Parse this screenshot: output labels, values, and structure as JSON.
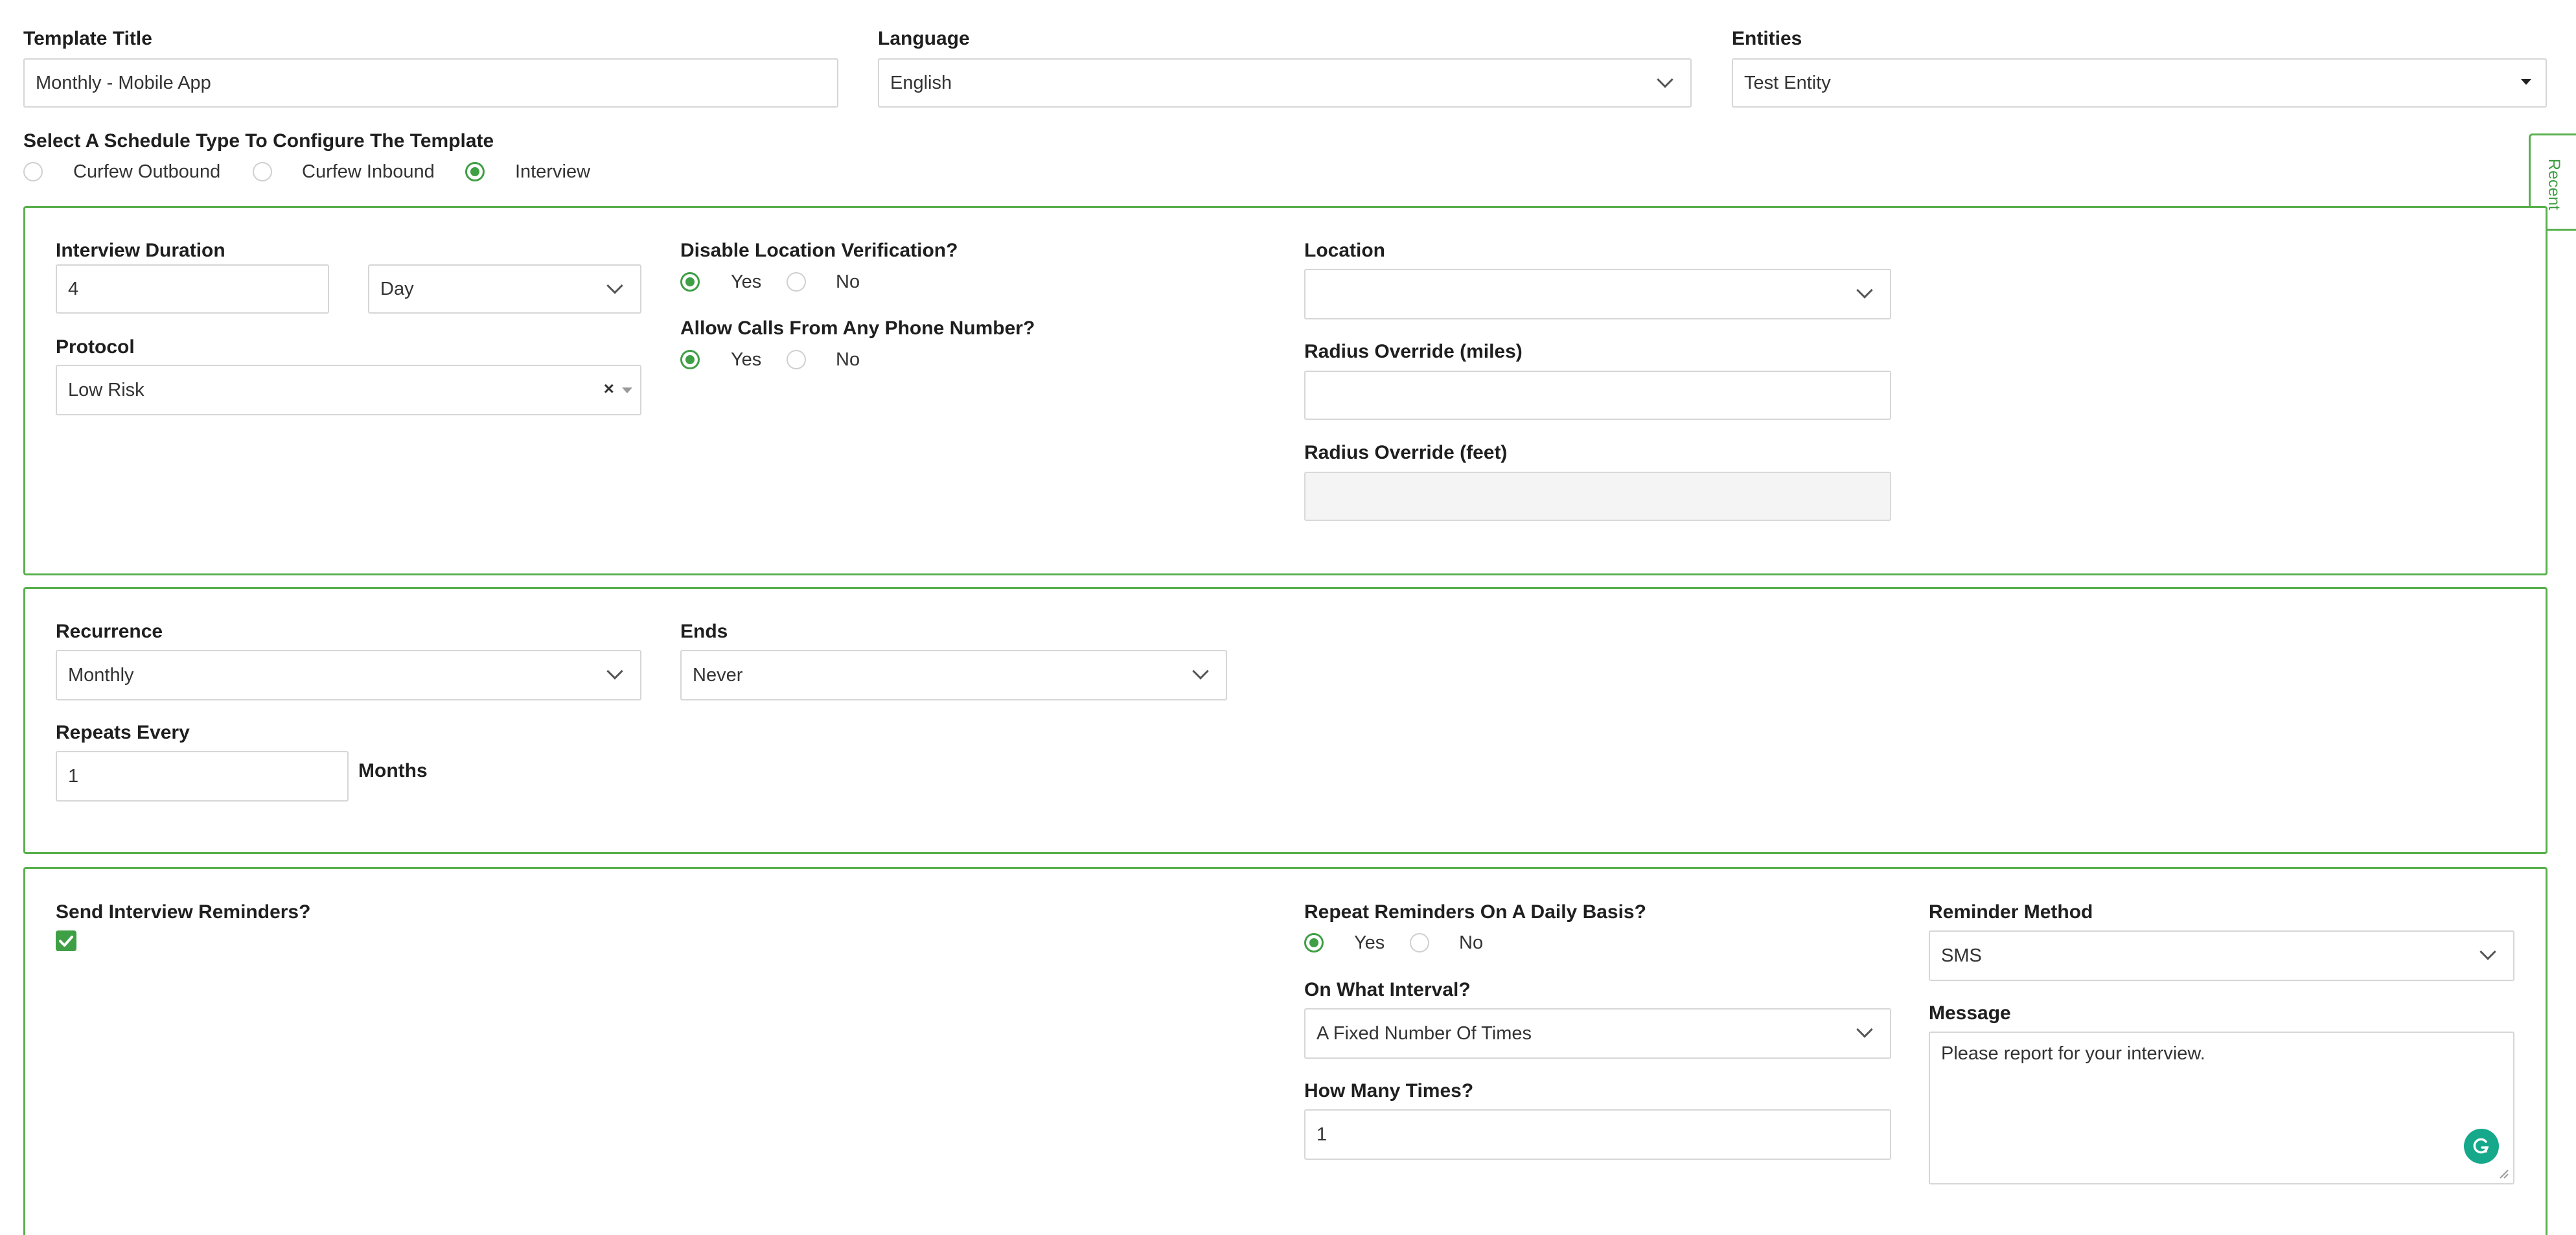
{
  "header": {
    "template_title_label": "Template Title",
    "template_title_value": "Monthly - Mobile App",
    "language_label": "Language",
    "language_value": "English",
    "entities_label": "Entities",
    "entities_value": "Test Entity"
  },
  "schedule_type": {
    "label": "Select A Schedule Type To Configure The Template",
    "options": [
      "Curfew Outbound",
      "Curfew Inbound",
      "Interview"
    ],
    "selected": "Interview"
  },
  "recent_tab": {
    "label": "Recent"
  },
  "interview_panel": {
    "duration_label": "Interview Duration",
    "duration_value": "4",
    "duration_unit": "Day",
    "protocol_label": "Protocol",
    "protocol_value": "Low Risk",
    "protocol_clear": "×",
    "disable_location_label": "Disable Location Verification?",
    "disable_location_yes": "Yes",
    "disable_location_no": "No",
    "disable_location_selected": "Yes",
    "allow_calls_label": "Allow Calls From Any Phone Number?",
    "allow_calls_yes": "Yes",
    "allow_calls_no": "No",
    "allow_calls_selected": "Yes",
    "location_label": "Location",
    "location_value": "",
    "radius_miles_label": "Radius Override (miles)",
    "radius_miles_value": "",
    "radius_feet_label": "Radius Override (feet)",
    "radius_feet_value": ""
  },
  "recurrence_panel": {
    "recurrence_label": "Recurrence",
    "recurrence_value": "Monthly",
    "ends_label": "Ends",
    "ends_value": "Never",
    "repeats_label": "Repeats Every",
    "repeats_value": "1",
    "repeats_unit": "Months"
  },
  "reminders_panel": {
    "send_label": "Send Interview Reminders?",
    "send_checked": true,
    "repeat_daily_label": "Repeat Reminders On A Daily Basis?",
    "repeat_daily_yes": "Yes",
    "repeat_daily_no": "No",
    "repeat_daily_selected": "Yes",
    "interval_label": "On What Interval?",
    "interval_value": "A Fixed Number Of Times",
    "how_many_label": "How Many Times?",
    "how_many_value": "1",
    "method_label": "Reminder Method",
    "method_value": "SMS",
    "message_label": "Message",
    "message_value": "Please report for your interview."
  },
  "colors": {
    "accent_green": "#58b04d",
    "radio_green": "#3f9f45",
    "checkbox_green": "#3f9f45",
    "grammarly_teal": "#15a88a"
  }
}
